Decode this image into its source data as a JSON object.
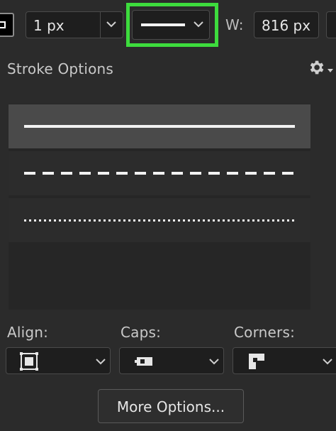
{
  "toolbar": {
    "stroke_width": {
      "value": "1 px"
    },
    "line_style": {
      "selected": "solid"
    },
    "width_label": "W:",
    "width_value": "816 px",
    "highlight_color": "#3ddc3d"
  },
  "panel": {
    "title": "Stroke Options",
    "settings_icon": "gear-icon",
    "styles": [
      {
        "name": "solid",
        "selected": true
      },
      {
        "name": "dashed",
        "selected": false
      },
      {
        "name": "dotted",
        "selected": false
      }
    ]
  },
  "options": {
    "align_label": "Align:",
    "align_icon": "stroke-align-inside-icon",
    "caps_label": "Caps:",
    "caps_icon": "butt-cap-icon",
    "corners_label": "Corners:",
    "corners_icon": "miter-join-icon",
    "more_button": "More Options..."
  }
}
